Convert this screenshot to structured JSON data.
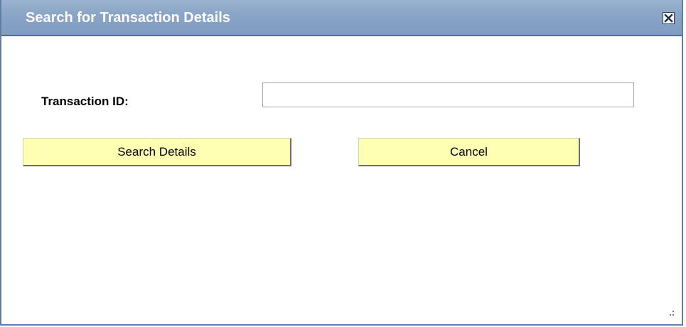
{
  "dialog": {
    "title": "Search for Transaction Details",
    "close_icon": "close-icon",
    "close_symbol": "✕"
  },
  "form": {
    "transaction_id_label": "Transaction ID:",
    "transaction_id_value": "",
    "transaction_id_placeholder": ""
  },
  "buttons": {
    "search_label": "Search Details",
    "cancel_label": "Cancel"
  },
  "colors": {
    "titlebar": "#8aa5c7",
    "button_bg": "#ffffb3",
    "border": "#5f7ea4"
  }
}
